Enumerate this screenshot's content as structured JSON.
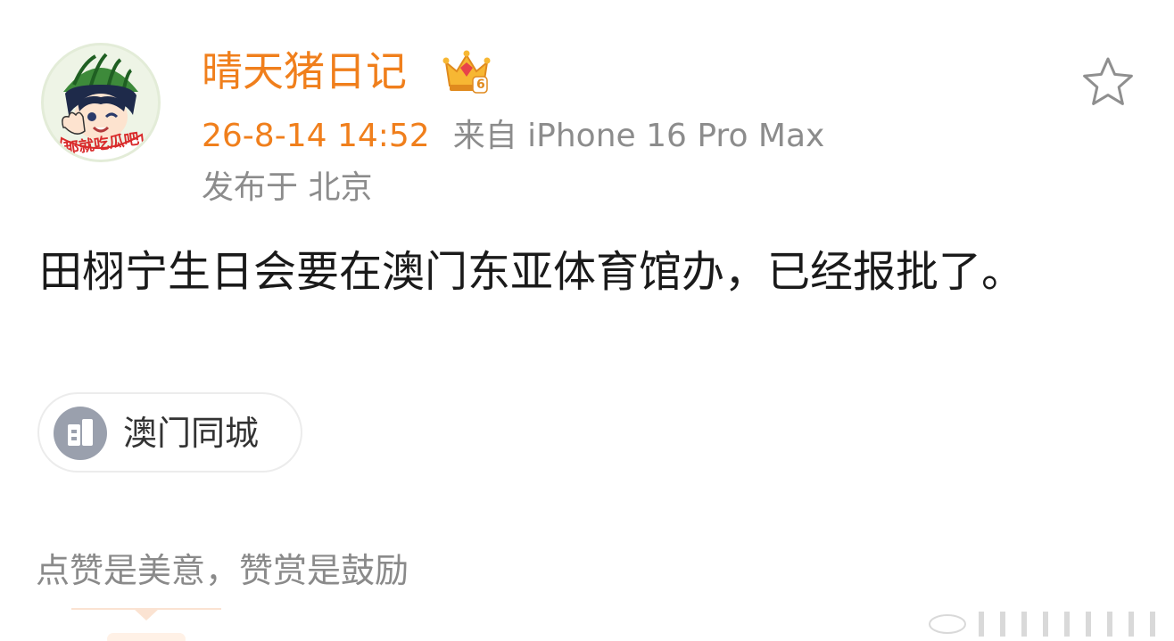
{
  "post": {
    "username": "晴天猪日记",
    "time": "26-8-14 14:52",
    "source": "来自 iPhone 16 Pro Max",
    "location": "发布于 北京",
    "text": "田栩宁生日会要在澳门东亚体育馆办，已经报批了。"
  },
  "topic": {
    "label": "澳门同城",
    "icon": "building-icon"
  },
  "avatar": {
    "sticker_text": "那就吃瓜吧"
  },
  "vip": {
    "level": "6",
    "icon": "crown-icon"
  },
  "reward": {
    "slogan": "点赞是美意，赞赏是鼓励"
  },
  "colors": {
    "accent_orange": "#f07f1c",
    "meta_gray": "#8c8c8c",
    "text_dark": "#1a1a1a"
  }
}
